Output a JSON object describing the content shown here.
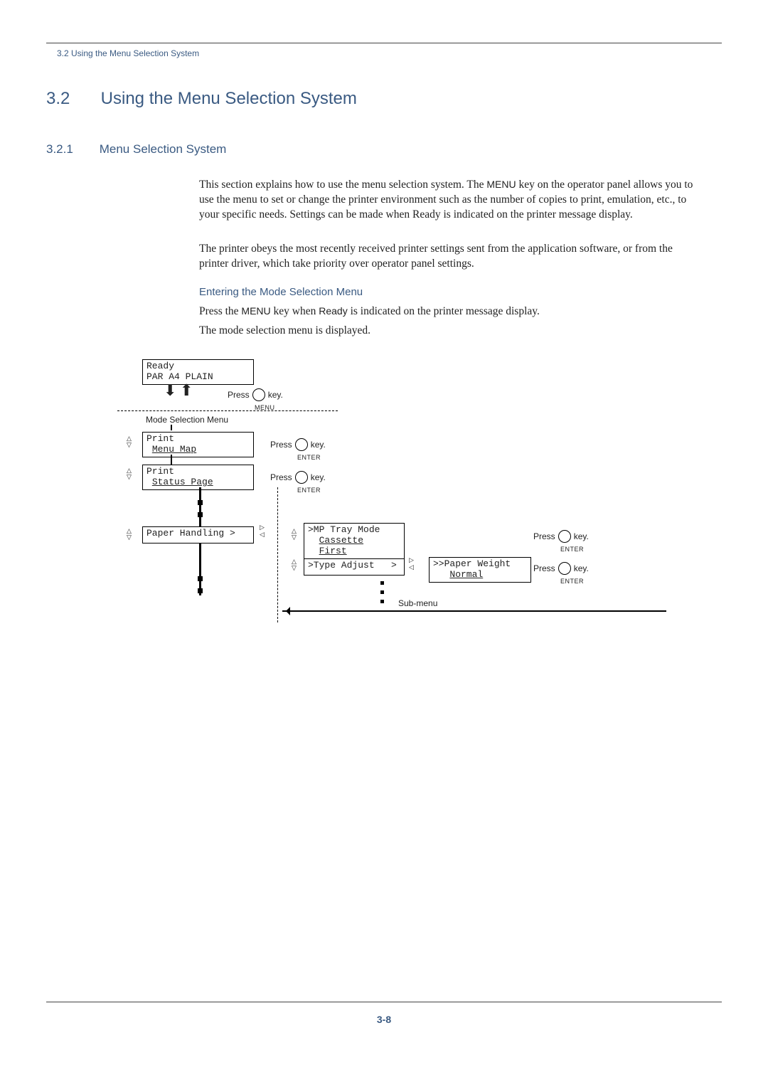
{
  "running_head": "3.2 Using the Menu Selection System",
  "h1": {
    "num": "3.2",
    "title": "Using the Menu Selection System"
  },
  "h2": {
    "num": "3.2.1",
    "title": "Menu Selection System"
  },
  "para1_a": "This section explains how to use the menu selection system. The ",
  "para1_menu": "MENU",
  "para1_b": " key on the operator panel allows you to use the menu to set or change the printer environment such as the number of copies to print, emulation, etc., to your specific needs. Settings can be made when Ready is indicated on the printer message display.",
  "para2": "The printer obeys the most recently received printer settings sent from the application software, or from the printer driver, which take priority over operator panel settings.",
  "h3": "Entering the Mode Selection Menu",
  "para3_a": "Press the ",
  "para3_menu": "MENU",
  "para3_b": " key when ",
  "para3_ready": "Ready",
  "para3_c": " is indicated on the printer message display.",
  "para4": "The mode selection menu is displayed.",
  "page_num": "3-8",
  "press": "Press",
  "key_label": "key.",
  "menu_label": "MENU",
  "enter_label": "ENTER",
  "mode_selection_menu": "Mode Selection Menu",
  "sub_menu_label": "Sub-menu",
  "lcd_ready_l1": "Ready",
  "lcd_ready_l2": "PAR A4 PLAIN",
  "lcd_print_l1": "Print",
  "lcd_menu_map_l2": "Menu Map",
  "lcd_status_l1": "Print",
  "lcd_status_l2": "Status Page",
  "lcd_paper": "Paper Handling >",
  "lcd_mptray_l1": ">MP Tray Mode",
  "lcd_mptray_l2a": "Cassette",
  "lcd_mptray_l2b": "First",
  "lcd_type_adj": ">Type Adjust   >",
  "lcd_paperweight_l1": ">>Paper Weight",
  "lcd_paperweight_l2": "Normal"
}
